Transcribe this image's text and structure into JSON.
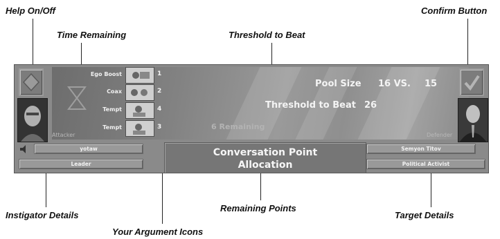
{
  "callouts": {
    "help": "Help On/Off",
    "time": "Time Remaining",
    "threshold": "Threshold to Beat",
    "confirm": "Confirm Button",
    "instigator": "Instigator Details",
    "remaining": "Remaining Points",
    "target": "Target Details",
    "argument": "Your Argument Icons"
  },
  "arguments": [
    {
      "label": "Ego Boost",
      "value": "1"
    },
    {
      "label": "Coax",
      "value": "2"
    },
    {
      "label": "Tempt",
      "value": "4"
    },
    {
      "label": "Tempt",
      "value": "3"
    }
  ],
  "pool": {
    "label": "Pool Size",
    "value": "16 VS.",
    "opponent": "15"
  },
  "threshold": {
    "label": "Threshold to Beat",
    "value": "26"
  },
  "remaining_text": "6 Remaining",
  "attacker_label": "Attacker",
  "defender_label": "Defender",
  "instigator": {
    "name": "yotaw",
    "role": "Leader"
  },
  "target": {
    "name": "Semyon Titov",
    "role": "Political Activist"
  },
  "center": {
    "line1": "Conversation Point",
    "line2": "Allocation"
  }
}
